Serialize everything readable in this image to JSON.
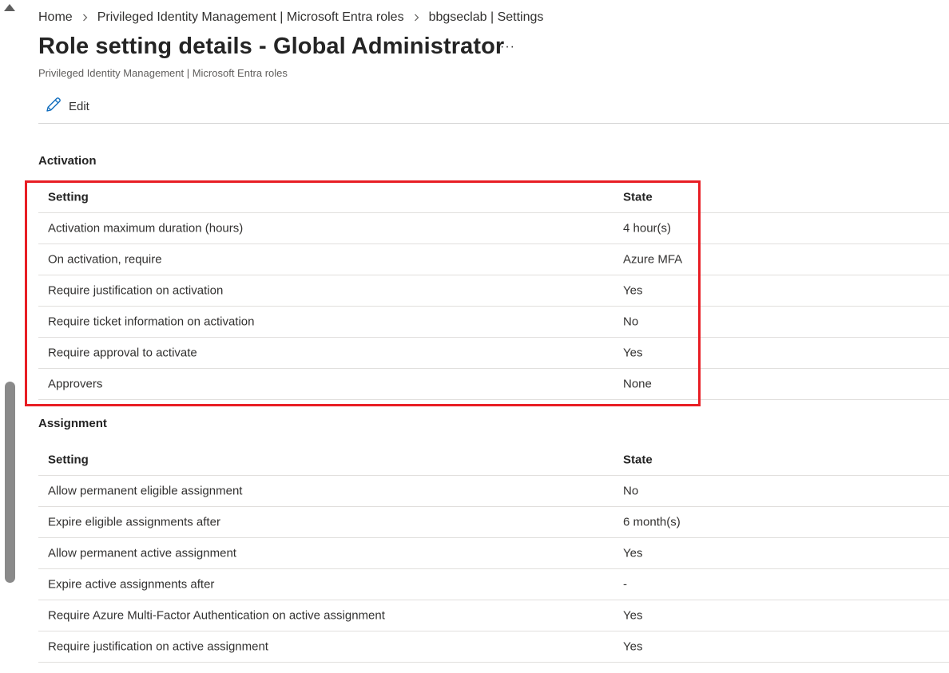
{
  "breadcrumb": [
    {
      "label": "Home"
    },
    {
      "label": "Privileged Identity Management | Microsoft Entra roles"
    },
    {
      "label": "bbgseclab | Settings"
    }
  ],
  "page": {
    "title": "Role setting details - Global Administrator",
    "more_label": "···",
    "subtitle": "Privileged Identity Management | Microsoft Entra roles"
  },
  "toolbar": {
    "edit_label": "Edit"
  },
  "activation": {
    "title": "Activation",
    "headers": {
      "setting": "Setting",
      "state": "State"
    },
    "rows": [
      {
        "setting": "Activation maximum duration (hours)",
        "state": "4 hour(s)"
      },
      {
        "setting": "On activation, require",
        "state": "Azure MFA"
      },
      {
        "setting": "Require justification on activation",
        "state": "Yes"
      },
      {
        "setting": "Require ticket information on activation",
        "state": "No"
      },
      {
        "setting": "Require approval to activate",
        "state": "Yes"
      },
      {
        "setting": "Approvers",
        "state": "None"
      }
    ]
  },
  "assignment": {
    "title": "Assignment",
    "headers": {
      "setting": "Setting",
      "state": "State"
    },
    "rows": [
      {
        "setting": "Allow permanent eligible assignment",
        "state": "No"
      },
      {
        "setting": "Expire eligible assignments after",
        "state": "6 month(s)"
      },
      {
        "setting": "Allow permanent active assignment",
        "state": "Yes"
      },
      {
        "setting": "Expire active assignments after",
        "state": "-"
      },
      {
        "setting": "Require Azure Multi-Factor Authentication on active assignment",
        "state": "Yes"
      },
      {
        "setting": "Require justification on active assignment",
        "state": "Yes"
      }
    ]
  },
  "colors": {
    "highlight": "#e81e24",
    "edit_icon": "#0f6cbd"
  },
  "icons": {
    "edit": "pencil-icon",
    "breadcrumb_separator": "chevron-right-icon",
    "scroll_up": "triangle-up-icon"
  }
}
